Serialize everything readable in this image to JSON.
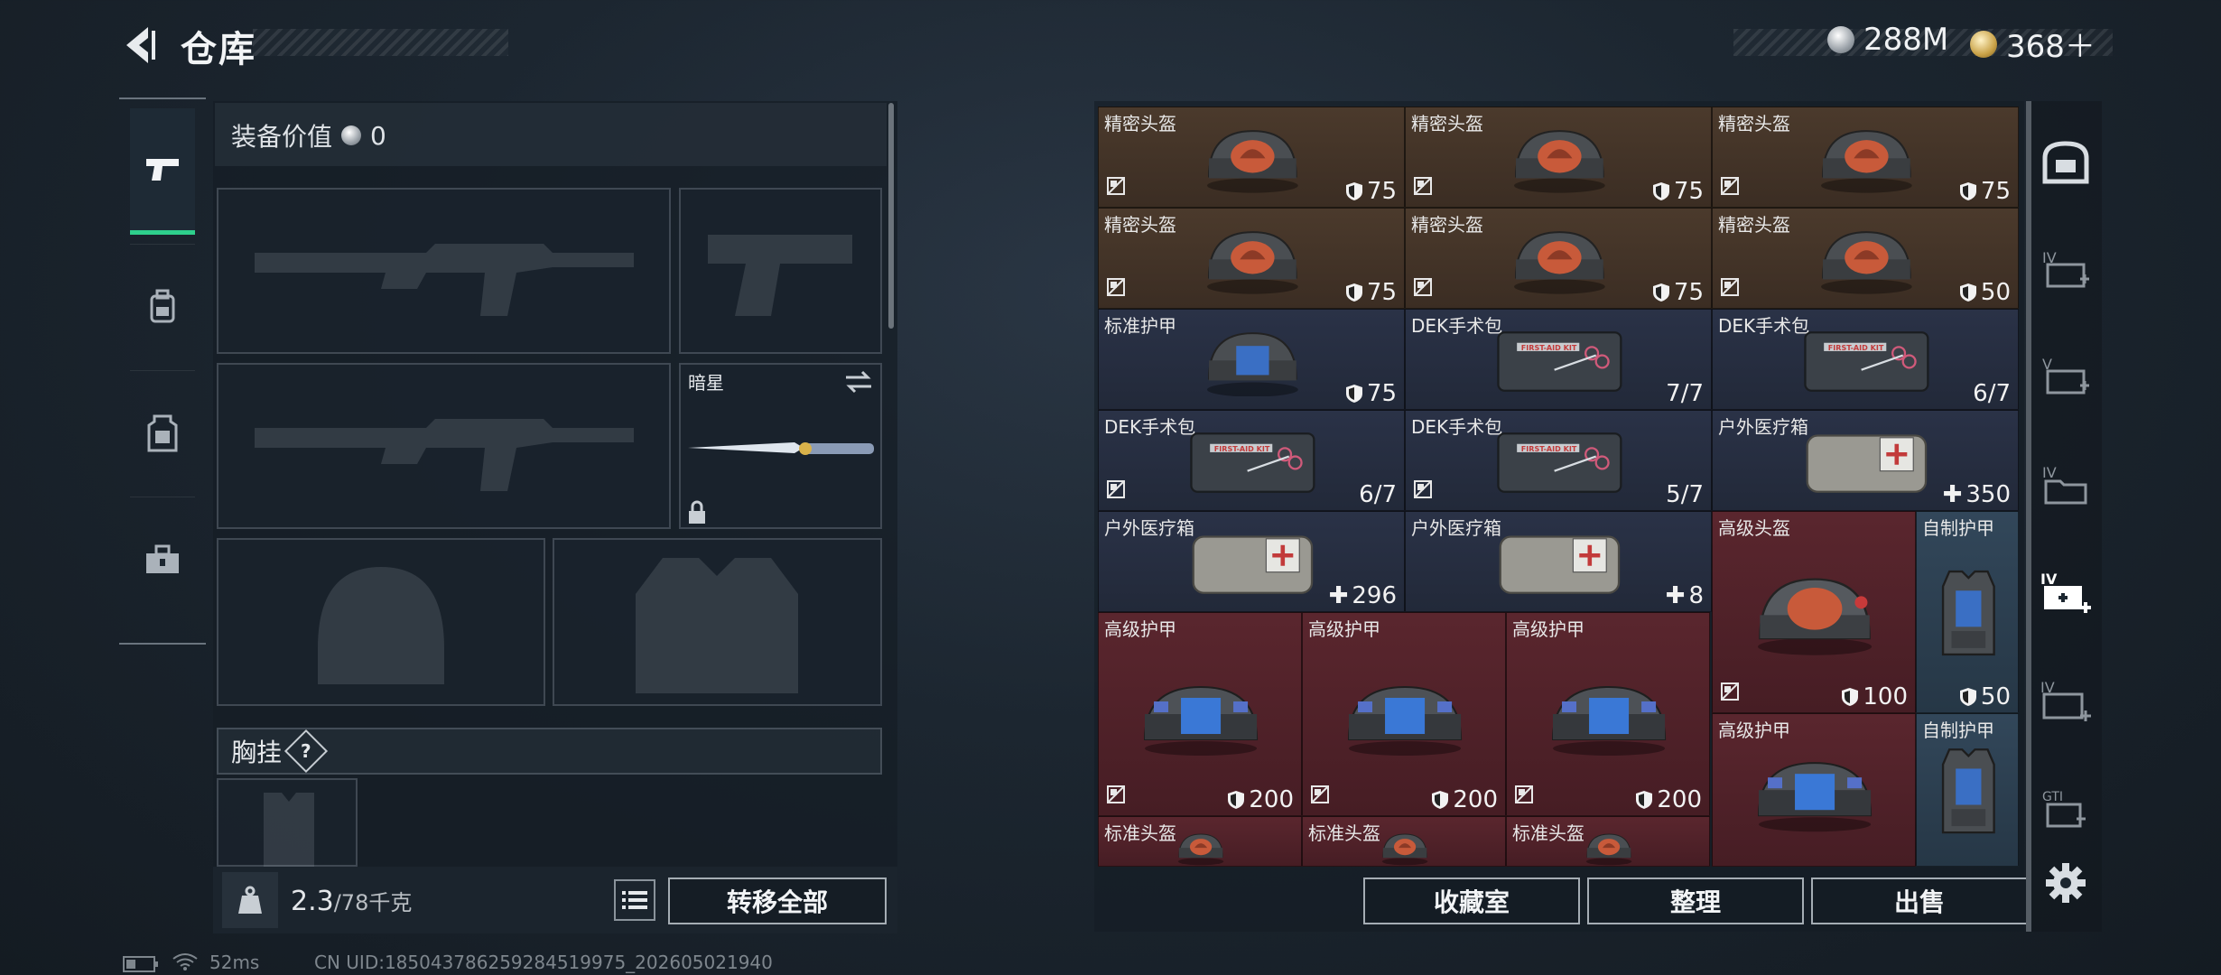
{
  "header": {
    "title": "仓库"
  },
  "currency": {
    "silver": "288M",
    "gold": "368＋"
  },
  "left_nav": [
    {
      "icon": "pistol-icon",
      "active": true
    },
    {
      "icon": "backpack-icon",
      "active": false
    },
    {
      "icon": "vest-icon",
      "active": false
    },
    {
      "icon": "toolbox-icon",
      "active": false
    }
  ],
  "equipment": {
    "value_label": "装备价值",
    "value": "0",
    "melee_name": "暗星",
    "chest_label": "胸挂",
    "chest_help": "?"
  },
  "bottom_left": {
    "weight": "2.3",
    "weight_max": "/78千克",
    "transfer_all": "转移全部"
  },
  "storage": {
    "items": [
      {
        "name": "精密头盔",
        "value": "75",
        "kind": "shield",
        "bg": "brown",
        "img": "helmet",
        "lock": true
      },
      {
        "name": "精密头盔",
        "value": "75",
        "kind": "shield",
        "bg": "brown",
        "img": "helmet",
        "lock": true
      },
      {
        "name": "精密头盔",
        "value": "75",
        "kind": "shield",
        "bg": "brown",
        "img": "helmet",
        "lock": true
      },
      {
        "name": "精密头盔",
        "value": "75",
        "kind": "shield",
        "bg": "brown",
        "img": "helmet",
        "lock": true
      },
      {
        "name": "精密头盔",
        "value": "75",
        "kind": "shield",
        "bg": "brown",
        "img": "helmet",
        "lock": true
      },
      {
        "name": "精密头盔",
        "value": "50",
        "kind": "shield",
        "bg": "brown",
        "img": "helmet",
        "lock": true
      },
      {
        "name": "标准护甲",
        "value": "75",
        "kind": "shield",
        "bg": "blue",
        "img": "armor",
        "lock": false
      },
      {
        "name": "DEK手术包",
        "value": "7/7",
        "kind": "count",
        "bg": "blue",
        "img": "kit",
        "lock": false
      },
      {
        "name": "DEK手术包",
        "value": "6/7",
        "kind": "count",
        "bg": "blue",
        "img": "kit",
        "lock": false
      },
      {
        "name": "DEK手术包",
        "value": "6/7",
        "kind": "count",
        "bg": "blue",
        "img": "kit",
        "lock": true
      },
      {
        "name": "DEK手术包",
        "value": "5/7",
        "kind": "count",
        "bg": "blue",
        "img": "kit",
        "lock": true
      },
      {
        "name": "户外医疗箱",
        "value": "350",
        "kind": "plus",
        "bg": "blue",
        "img": "medbox",
        "lock": false
      },
      {
        "name": "户外医疗箱",
        "value": "296",
        "kind": "plus",
        "bg": "blue",
        "img": "medbox",
        "lock": false
      },
      {
        "name": "户外医疗箱",
        "value": "8",
        "kind": "plus",
        "bg": "blue",
        "img": "medbox",
        "lock": false
      },
      {
        "name": "高级头盔",
        "value": "100",
        "kind": "shield",
        "bg": "red",
        "img": "helmet-big",
        "lock": true
      },
      {
        "name": "自制护甲",
        "value": "50",
        "kind": "shield",
        "bg": "steel",
        "img": "vest",
        "lock": false
      },
      {
        "name": "高级护甲",
        "value": "200",
        "kind": "shield",
        "bg": "red",
        "img": "armor-big",
        "lock": true
      },
      {
        "name": "高级护甲",
        "value": "200",
        "kind": "shield",
        "bg": "red",
        "img": "armor-big",
        "lock": true
      },
      {
        "name": "高级护甲",
        "value": "200",
        "kind": "shield",
        "bg": "red",
        "img": "armor-big",
        "lock": true
      },
      {
        "name": "高级护甲",
        "value": "",
        "kind": "none",
        "bg": "red",
        "img": "armor-big",
        "lock": false
      },
      {
        "name": "自制护甲",
        "value": "",
        "kind": "none",
        "bg": "steel",
        "img": "vest",
        "lock": false
      },
      {
        "name": "标准头盔",
        "value": "",
        "kind": "none",
        "bg": "red",
        "img": "helmet",
        "lock": false
      },
      {
        "name": "标准头盔",
        "value": "",
        "kind": "none",
        "bg": "red",
        "img": "helmet",
        "lock": false
      },
      {
        "name": "标准头盔",
        "value": "",
        "kind": "none",
        "bg": "red",
        "img": "helmet",
        "lock": false
      }
    ]
  },
  "storage_buttons": {
    "collection": "收藏室",
    "sort": "整理",
    "sell": "出售"
  },
  "right_side": [
    {
      "icon": "safe-icon"
    },
    {
      "icon": "iv-bag-add-icon"
    },
    {
      "icon": "v-bag-add-icon"
    },
    {
      "icon": "iv-folder-icon"
    },
    {
      "icon": "iv-medkit-add-icon"
    },
    {
      "icon": "iv-medkit-add-icon-2"
    },
    {
      "icon": "gti-bag-icon"
    }
  ],
  "status": {
    "ping": "52ms",
    "uid": "CN UID:185043786259284519975_202605021940"
  },
  "colors": {
    "accent_green": "#2ecf8c",
    "brown_cell": "#4b3a2c",
    "blue_cell": "#2a3247",
    "red_cell": "#5a262e"
  }
}
